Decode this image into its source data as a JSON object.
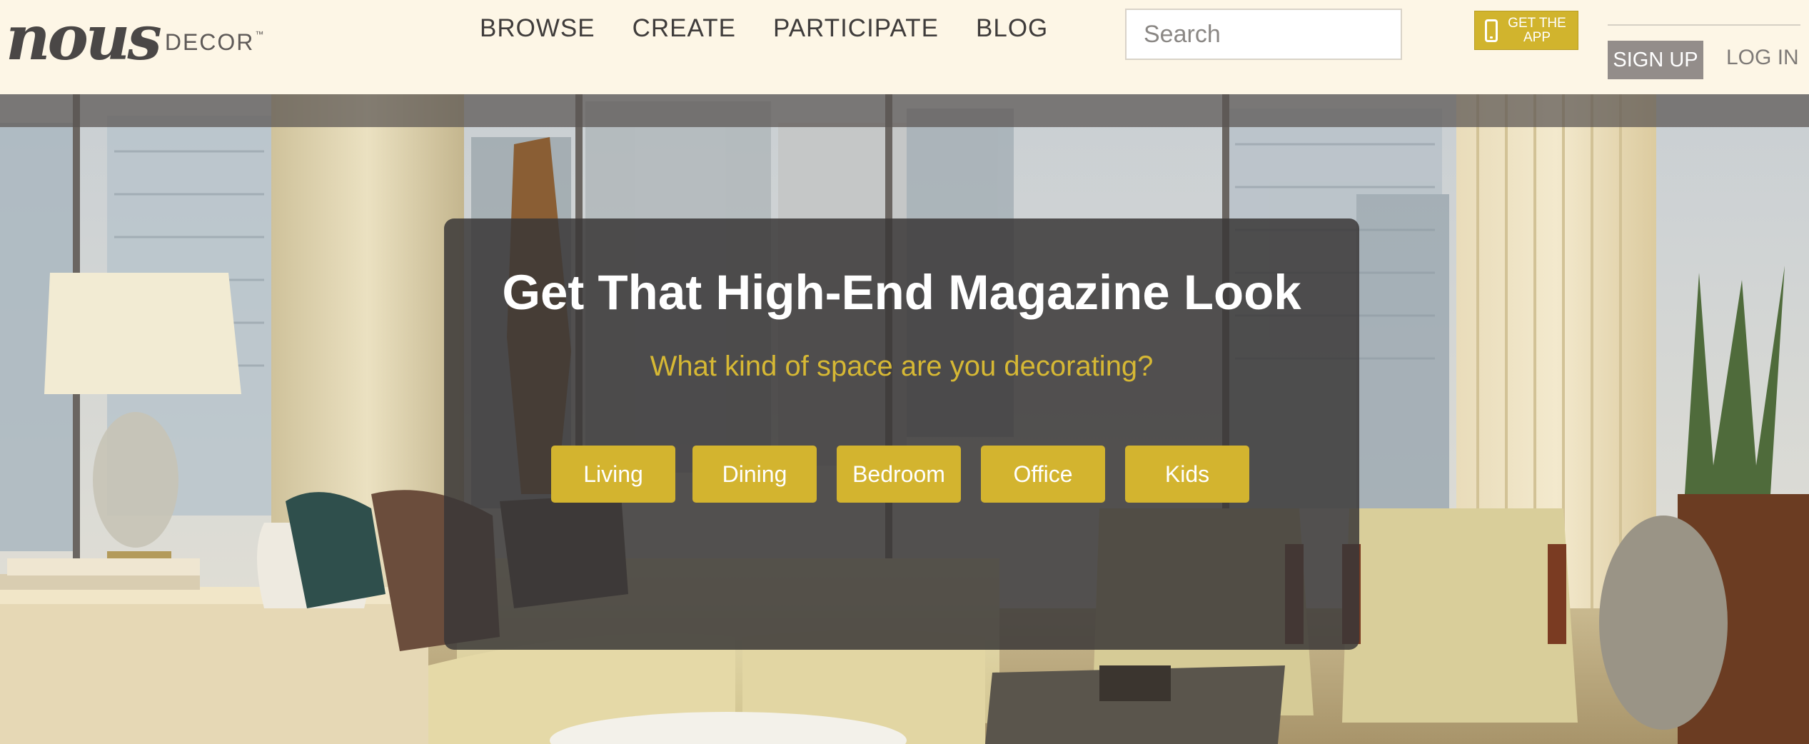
{
  "header": {
    "logo_script": "nous",
    "logo_word": "DECOR",
    "logo_tm": "™",
    "nav": [
      "BROWSE",
      "CREATE",
      "PARTICIPATE",
      "BLOG"
    ],
    "search_placeholder": "Search",
    "get_app_line1": "GET THE",
    "get_app_line2": "APP",
    "signup_label": "SIGN UP",
    "login_label": "LOG IN"
  },
  "hero": {
    "title": "Get That High-End Magazine Look",
    "subtitle": "What kind of space are you decorating?",
    "spaces": [
      "Living",
      "Dining",
      "Bedroom",
      "Office",
      "Kids"
    ]
  },
  "colors": {
    "accent_gold": "#d3b42f",
    "header_bg": "#fdf6e6",
    "panel_bg": "#3a3737"
  }
}
